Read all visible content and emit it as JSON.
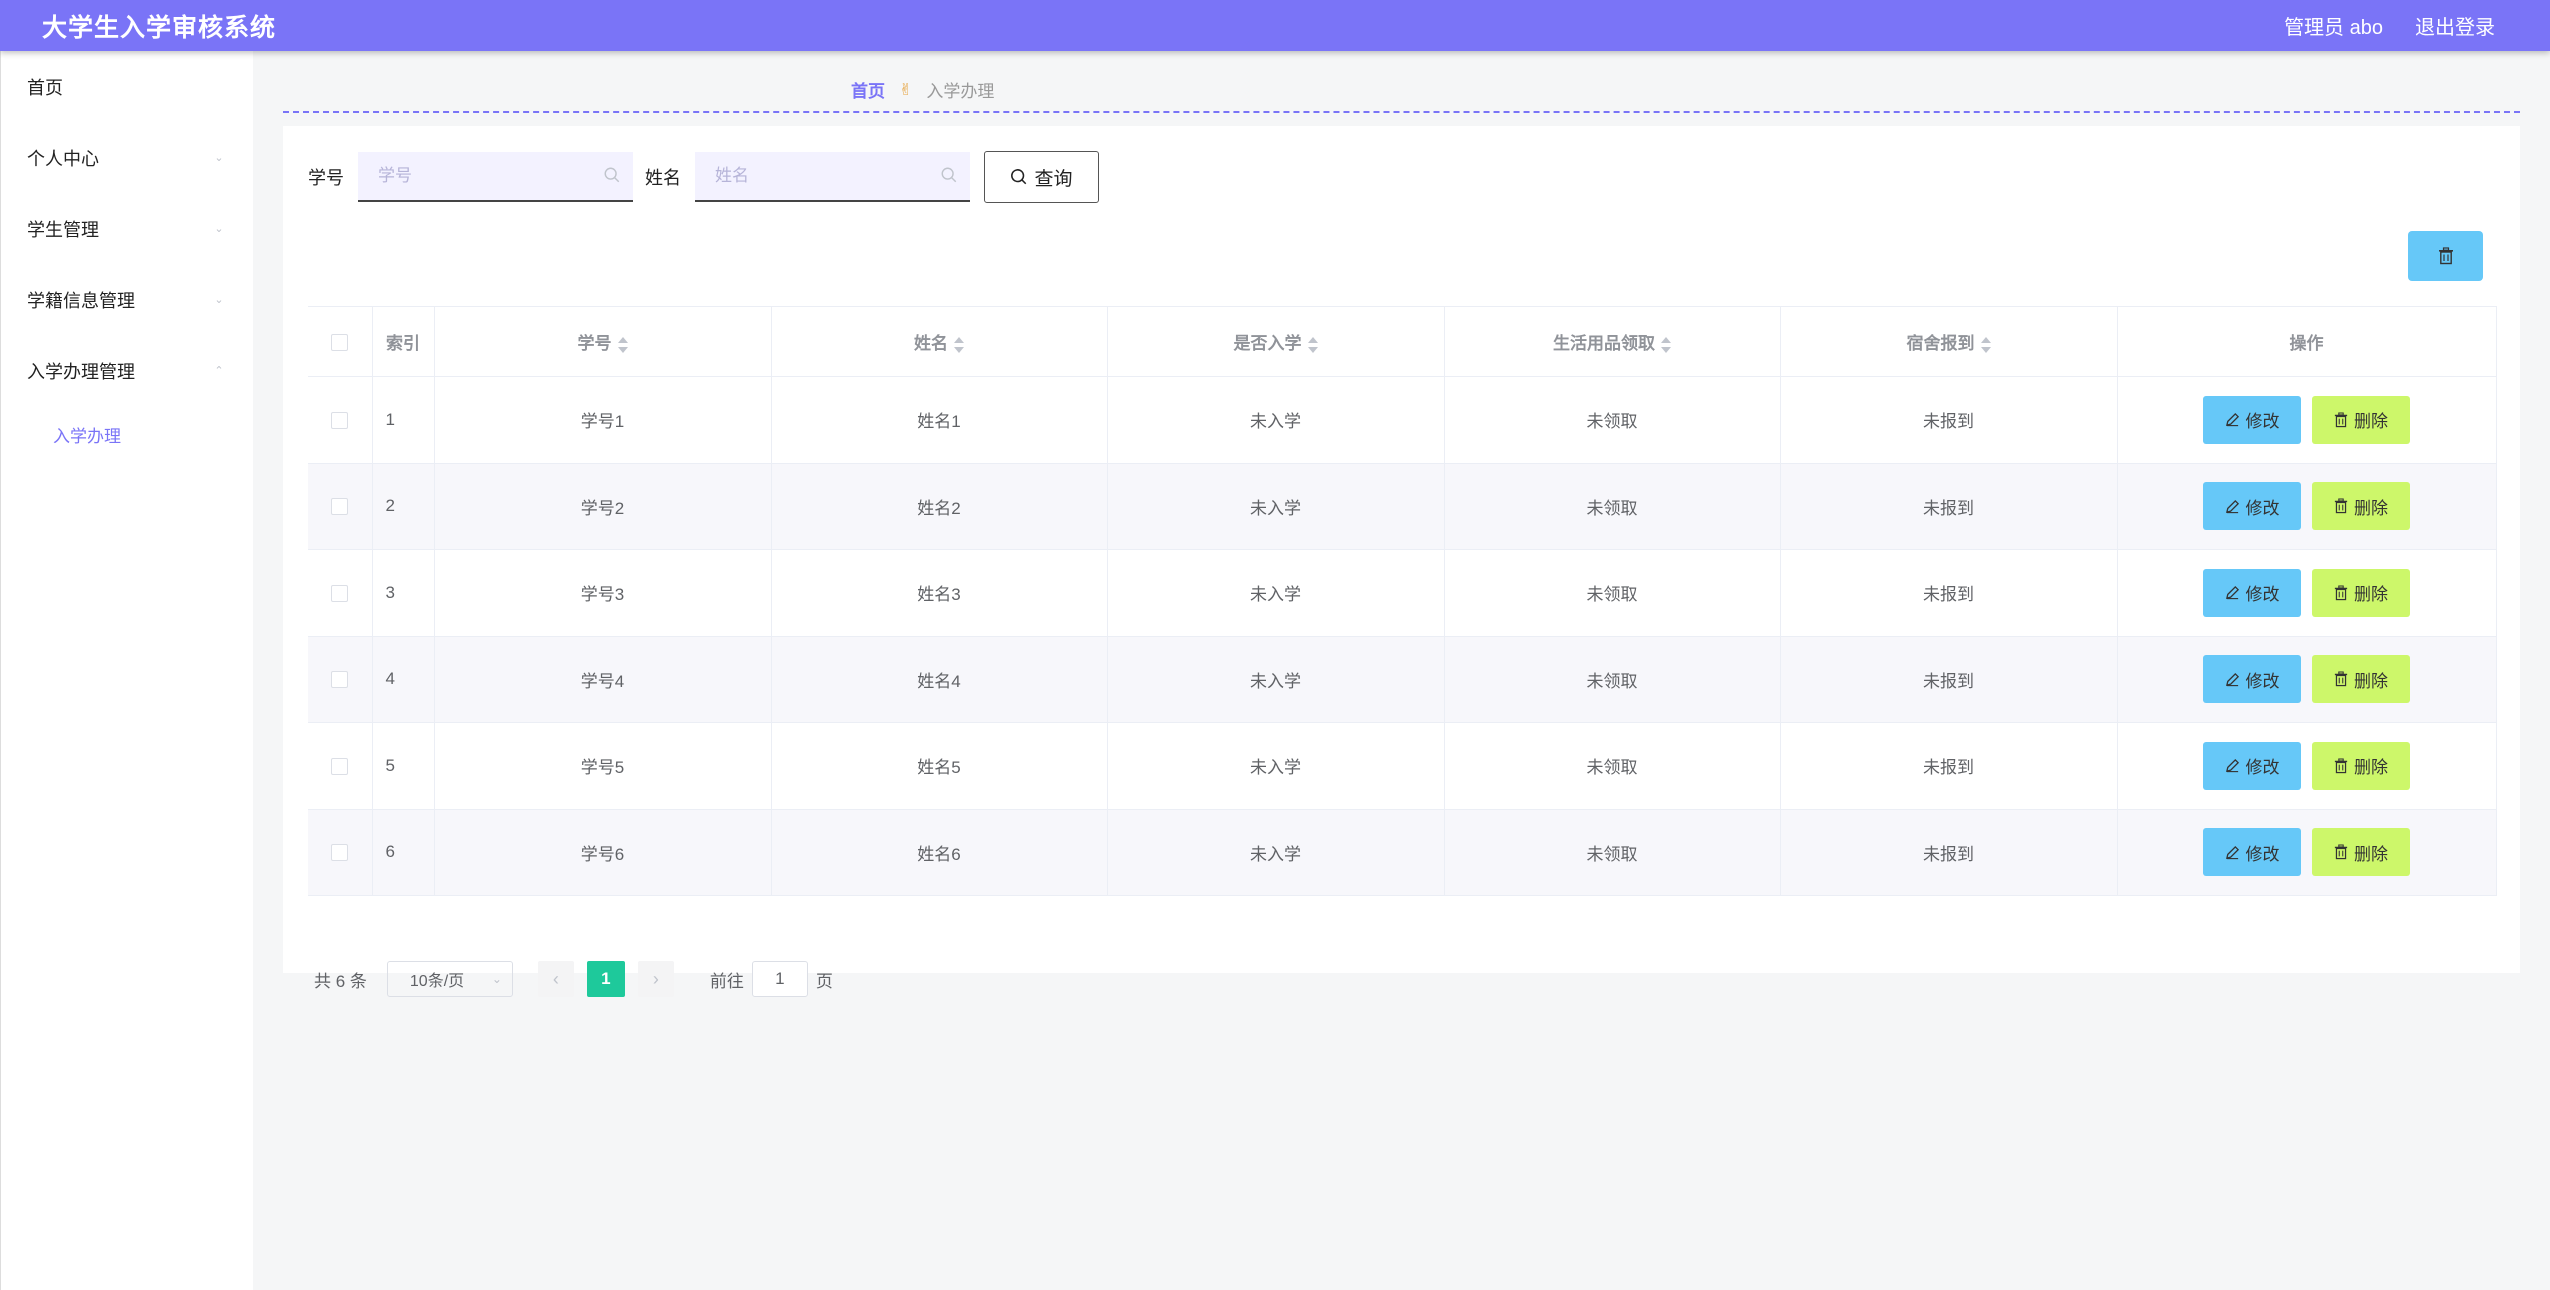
{
  "app": {
    "title": "大学生入学审核系统",
    "user_label": "管理员 abo",
    "logout_label": "退出登录"
  },
  "sidebar": {
    "items": [
      {
        "label": "首页"
      },
      {
        "label": "个人中心"
      },
      {
        "label": "学生管理"
      },
      {
        "label": "学籍信息管理"
      },
      {
        "label": "入学办理管理"
      }
    ],
    "sub_items": [
      {
        "label": "入学办理"
      }
    ]
  },
  "breadcrumb": {
    "home": "首页",
    "current": "入学办理"
  },
  "search": {
    "student_id_label": "学号",
    "student_id_placeholder": "学号",
    "student_id_value": "",
    "name_label": "姓名",
    "name_placeholder": "姓名",
    "name_value": "",
    "query_label": "查询"
  },
  "table": {
    "columns": [
      "索引",
      "学号",
      "姓名",
      "是否入学",
      "生活用品领取",
      "宿舍报到",
      "操作"
    ],
    "edit_label": "修改",
    "delete_label": "删除",
    "rows": [
      {
        "index": "1",
        "student_id": "学号1",
        "name": "姓名1",
        "enrolled": "未入学",
        "supplies": "未领取",
        "dorm": "未报到"
      },
      {
        "index": "2",
        "student_id": "学号2",
        "name": "姓名2",
        "enrolled": "未入学",
        "supplies": "未领取",
        "dorm": "未报到"
      },
      {
        "index": "3",
        "student_id": "学号3",
        "name": "姓名3",
        "enrolled": "未入学",
        "supplies": "未领取",
        "dorm": "未报到"
      },
      {
        "index": "4",
        "student_id": "学号4",
        "name": "姓名4",
        "enrolled": "未入学",
        "supplies": "未领取",
        "dorm": "未报到"
      },
      {
        "index": "5",
        "student_id": "学号5",
        "name": "姓名5",
        "enrolled": "未入学",
        "supplies": "未领取",
        "dorm": "未报到"
      },
      {
        "index": "6",
        "student_id": "学号6",
        "name": "姓名6",
        "enrolled": "未入学",
        "supplies": "未领取",
        "dorm": "未报到"
      }
    ]
  },
  "pagination": {
    "total": "共 6 条",
    "page_size": "10条/页",
    "current_page": "1",
    "goto_label": "前往",
    "goto_value": "1",
    "goto_suffix": "页"
  },
  "colors": {
    "header": "#7a74f7",
    "edit_button": "#66c8f8",
    "delete_button": "#cdf76a",
    "active_page": "#1ec99b"
  }
}
